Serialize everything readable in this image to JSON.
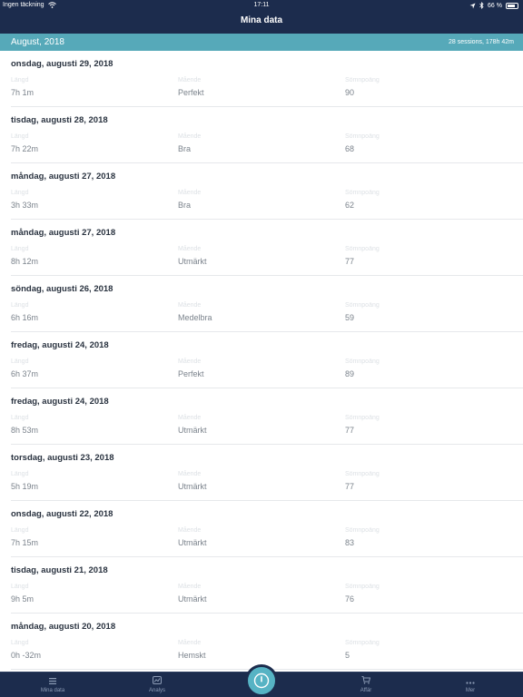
{
  "status_bar": {
    "carrier": "Ingen täckning",
    "time": "17:11",
    "battery": "66 %"
  },
  "header": {
    "title": "Mina data"
  },
  "month": {
    "title": "August, 2018",
    "summary": "28 sessions, 178h 42m"
  },
  "columns": {
    "length": "Längd",
    "mood": "Mående",
    "score": "Sömnpoäng"
  },
  "sessions": [
    {
      "date": "onsdag, augusti 29, 2018",
      "length": "7h 1m",
      "mood": "Perfekt",
      "score": "90"
    },
    {
      "date": "tisdag, augusti 28, 2018",
      "length": "7h 22m",
      "mood": "Bra",
      "score": "68"
    },
    {
      "date": "måndag, augusti 27, 2018",
      "length": "3h 33m",
      "mood": "Bra",
      "score": "62"
    },
    {
      "date": "måndag, augusti 27, 2018",
      "length": "8h 12m",
      "mood": "Utmärkt",
      "score": "77"
    },
    {
      "date": "söndag, augusti 26, 2018",
      "length": "6h 16m",
      "mood": "Medelbra",
      "score": "59"
    },
    {
      "date": "fredag, augusti 24, 2018",
      "length": "6h 37m",
      "mood": "Perfekt",
      "score": "89"
    },
    {
      "date": "fredag, augusti 24, 2018",
      "length": "8h 53m",
      "mood": "Utmärkt",
      "score": "77"
    },
    {
      "date": "torsdag, augusti 23, 2018",
      "length": "5h 19m",
      "mood": "Utmärkt",
      "score": "77"
    },
    {
      "date": "onsdag, augusti 22, 2018",
      "length": "7h 15m",
      "mood": "Utmärkt",
      "score": "83"
    },
    {
      "date": "tisdag, augusti 21, 2018",
      "length": "9h 5m",
      "mood": "Utmärkt",
      "score": "76"
    },
    {
      "date": "måndag, augusti 20, 2018",
      "length": "0h -32m",
      "mood": "Hemskt",
      "score": "5"
    }
  ],
  "tabs": {
    "my_data": "Mina data",
    "analysis": "Analys",
    "shop": "Affär",
    "more": "Mer"
  },
  "icons": {
    "wifi": "wifi-icon",
    "location": "location-arrow-icon",
    "bluetooth": "bluetooth-icon",
    "battery": "battery-icon",
    "list": "list-icon",
    "analysis": "chart-icon",
    "power": "power-icon",
    "shop": "cart-icon",
    "more": "more-dots-icon"
  },
  "colors": {
    "nav_background": "#1c2c4d",
    "month_bar": "#56a9b9",
    "accent": "#56b3c4"
  }
}
